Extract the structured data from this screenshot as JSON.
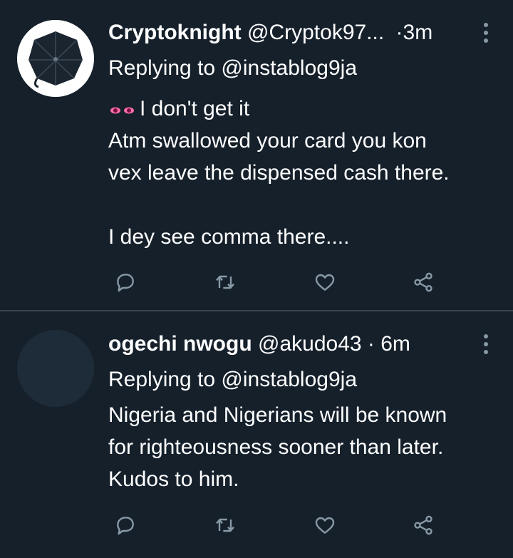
{
  "theme": {
    "background": "#15202b",
    "divider": "#38444d",
    "icon_color": "#8899a6",
    "text_color": "#ffffff"
  },
  "tweets": [
    {
      "name": "Cryptoknight",
      "handle": "@Cryptok97...",
      "separator": "·",
      "time": "3m",
      "reply_label": "Replying to @instablog9ja",
      "lines": [
        "I don't get it",
        "Atm swallowed your card you kon",
        "vex leave the dispensed cash there.",
        "",
        "I dey see comma there...."
      ],
      "leading_emoji": "eyes",
      "avatar": "umbrella-avatar",
      "actions": [
        "reply-icon",
        "retweet-icon",
        "like-icon",
        "share-icon"
      ]
    },
    {
      "name": "ogechi nwogu",
      "handle": "@akudo43",
      "separator": "·",
      "time": "6m",
      "reply_label": "Replying to @instablog9ja",
      "lines": [
        "Nigeria and Nigerians will be known",
        "for righteousness sooner than later.",
        "Kudos to him."
      ],
      "avatar": "default-avatar",
      "actions": [
        "reply-icon",
        "retweet-icon",
        "like-icon",
        "share-icon"
      ]
    }
  ]
}
